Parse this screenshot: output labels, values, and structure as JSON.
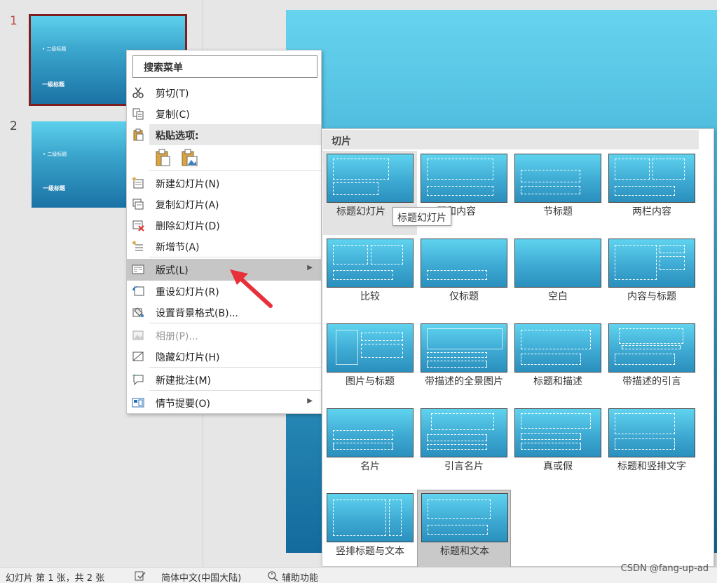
{
  "thumbnails": [
    {
      "num": "1",
      "bullet": "• 二级标题",
      "title": "一级标题"
    },
    {
      "num": "2",
      "bullet": "• 二级标题",
      "title": "一级标题"
    }
  ],
  "context_menu": {
    "search_placeholder": "搜索菜单",
    "cut": "剪切(T)",
    "copy": "复制(C)",
    "paste_header": "粘贴选项:",
    "new_slide": "新建幻灯片(N)",
    "duplicate_slide": "复制幻灯片(A)",
    "delete_slide": "删除幻灯片(D)",
    "add_section": "新增节(A)",
    "layout": "版式(L)",
    "reset_slide": "重设幻灯片(R)",
    "format_background": "设置背景格式(B)...",
    "photo_album": "相册(P)...",
    "hide_slide": "隐藏幻灯片(H)",
    "new_comment": "新建批注(M)",
    "storyboard": "情节提要(O)"
  },
  "gallery": {
    "header": "切片",
    "layouts": [
      "标题幻灯片",
      "标题和内容",
      "节标题",
      "两栏内容",
      "比较",
      "仅标题",
      "空白",
      "内容与标题",
      "图片与标题",
      "带描述的全景图片",
      "标题和描述",
      "带描述的引言",
      "名片",
      "引言名片",
      "真或假",
      "标题和竖排文字",
      "竖排标题与文本",
      "标题和文本"
    ],
    "first_caption_visible": "标题幻灯片",
    "second_caption_visible": "题和内容",
    "tooltip": "标题幻灯片"
  },
  "status": {
    "slide_info": "幻灯片 第 1 张，共 2 张",
    "language": "简体中文(中国大陆)",
    "accessibility": "辅助功能",
    "watermark": "CSDN @fang-up-ad"
  },
  "colors": {
    "accent_selected": "#7b1f1f",
    "slide_top": "#5dd0ec",
    "slide_bottom": "#1a72a4",
    "arrow": "#e8303a"
  }
}
